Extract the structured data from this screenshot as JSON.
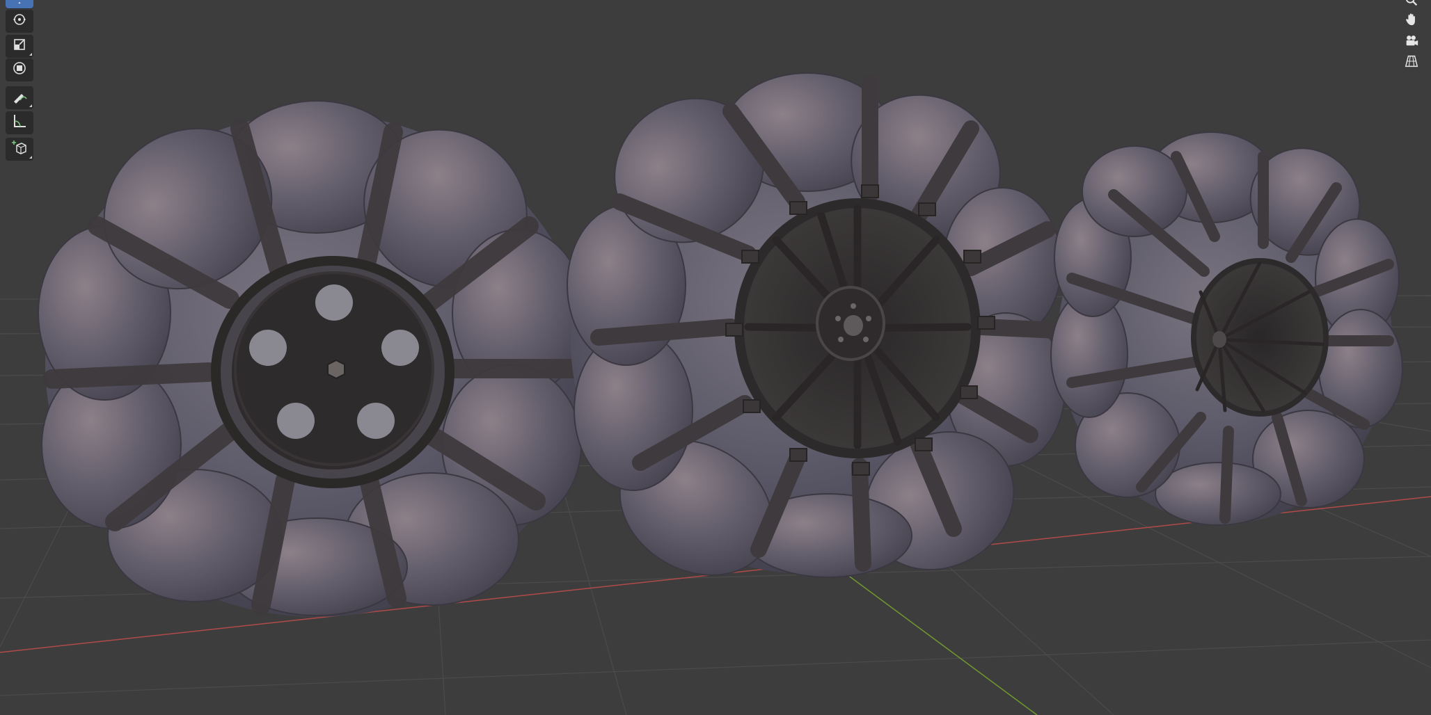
{
  "viewport": {
    "background": "#3d3d3d",
    "grid_color": "#4a4a4a",
    "x_axis_color": "#b34a4a",
    "y_axis_color": "#6e9a2e",
    "objects": [
      "wheel-solid-hub",
      "wheel-spoked-large",
      "wheel-spoked-small"
    ]
  },
  "left_toolbar": {
    "tools": [
      {
        "icon": "move-icon",
        "active": true
      },
      {
        "icon": "rotate-icon",
        "active": false
      },
      {
        "icon": "scale-icon",
        "active": false
      },
      {
        "icon": "transform-icon",
        "active": false
      },
      {
        "icon": "annotate-icon",
        "active": false
      },
      {
        "icon": "measure-icon",
        "active": false
      },
      {
        "icon": "add-cube-icon",
        "active": false
      }
    ]
  },
  "nav_gizmo": {
    "buttons": [
      "zoom-icon",
      "pan-hand-icon",
      "camera-icon",
      "perspective-grid-icon"
    ]
  },
  "materials": {
    "tire_base": "#5b5a68",
    "tire_highlight": "#8a7f83",
    "strap": "#3f3b3e",
    "metal": "#2c2928"
  }
}
